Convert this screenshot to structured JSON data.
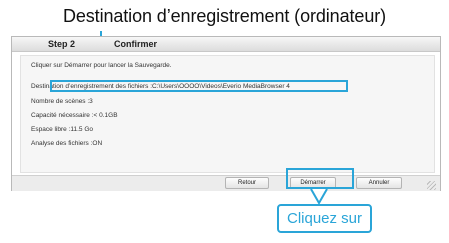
{
  "annotation": {
    "top_callout": "Destination d’enregistrement (ordinateur)",
    "click_callout": "Cliquez sur",
    "accent_color": "#2aa5d8"
  },
  "dialog": {
    "step": "Step 2",
    "title": "Confirmer",
    "instruction": "Cliquer sur Démarrer pour lancer la Sauvegarde.",
    "destination": "Destination d’enregistrement des fichiers :C:\\Users\\OOOO\\Videos\\Everio MediaBrowser 4",
    "scene_count": "Nombre de scènes :3",
    "capacity": "Capacité nécessaire :< 0.1GB",
    "free_space": "Espace libre :11.5 Go",
    "analysis": "Analyse des fichiers :ON"
  },
  "buttons": {
    "back": "Retour",
    "start": "Démarrer",
    "cancel": "Annuler"
  }
}
